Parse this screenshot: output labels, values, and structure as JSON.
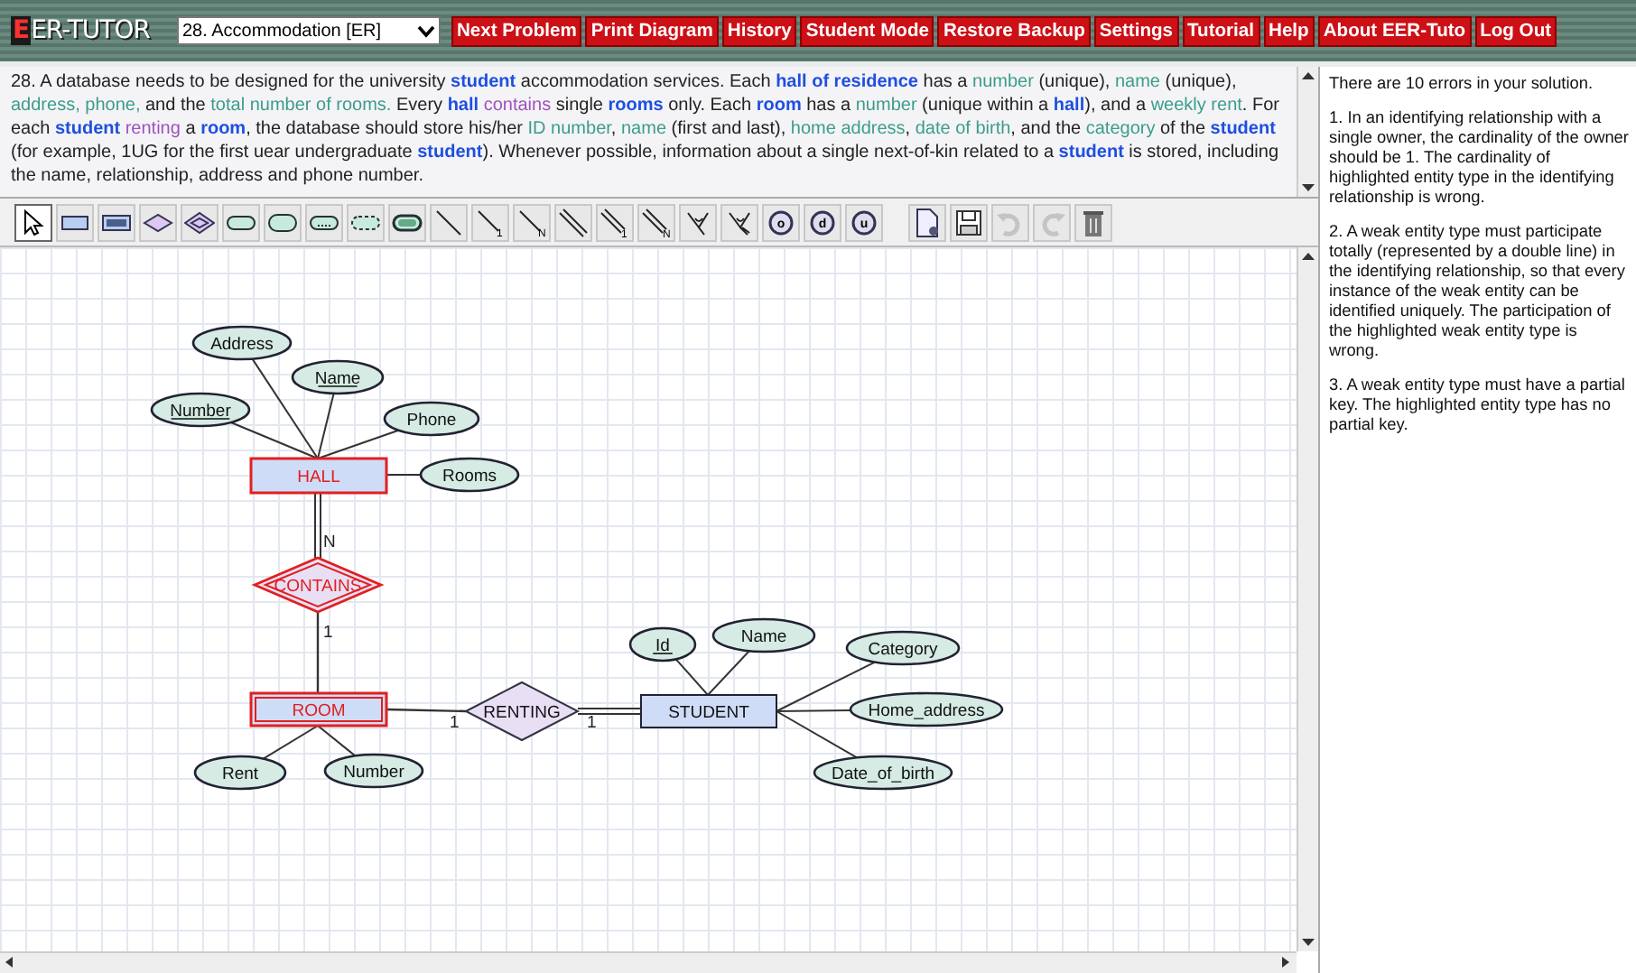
{
  "top_bar": {
    "logo": {
      "first_letter": "E",
      "rest": "ER-TUTOR"
    },
    "problem_select": {
      "value": "28. Accommodation [ER]"
    },
    "menu": [
      {
        "label": "Next Problem"
      },
      {
        "label": "Print Diagram"
      },
      {
        "label": "History"
      },
      {
        "label": "Student Mode"
      },
      {
        "label": "Restore Backup"
      },
      {
        "label": "Settings"
      },
      {
        "label": "Tutorial"
      },
      {
        "label": "Help"
      },
      {
        "label": "About EER-Tuto"
      },
      {
        "label": "Log Out"
      }
    ]
  },
  "problem_text": [
    {
      "kind": "plain",
      "text": "28. A database needs to be designed for the university "
    },
    {
      "kind": "entity",
      "text": "student"
    },
    {
      "kind": "plain",
      "text": " accommodation services. Each "
    },
    {
      "kind": "entity",
      "text": "hall of residence"
    },
    {
      "kind": "plain",
      "text": " has a "
    },
    {
      "kind": "attribute",
      "text": "number"
    },
    {
      "kind": "plain",
      "text": " (unique), "
    },
    {
      "kind": "attribute",
      "text": "name"
    },
    {
      "kind": "plain",
      "text": " (unique), "
    },
    {
      "kind": "attribute",
      "text": "address, phone,"
    },
    {
      "kind": "plain",
      "text": " and the "
    },
    {
      "kind": "attribute",
      "text": "total number of rooms."
    },
    {
      "kind": "plain",
      "text": " Every "
    },
    {
      "kind": "entity",
      "text": "hall"
    },
    {
      "kind": "relationship",
      "text": " contains"
    },
    {
      "kind": "plain",
      "text": " single "
    },
    {
      "kind": "entity",
      "text": "rooms"
    },
    {
      "kind": "plain",
      "text": " only. Each "
    },
    {
      "kind": "entity",
      "text": "room"
    },
    {
      "kind": "plain",
      "text": " has a "
    },
    {
      "kind": "attribute",
      "text": "number"
    },
    {
      "kind": "plain",
      "text": " (unique within a "
    },
    {
      "kind": "entity",
      "text": "hall"
    },
    {
      "kind": "plain",
      "text": "), and a "
    },
    {
      "kind": "attribute",
      "text": "weekly rent"
    },
    {
      "kind": "plain",
      "text": ". For each "
    },
    {
      "kind": "entity",
      "text": "student"
    },
    {
      "kind": "relationship",
      "text": " renting"
    },
    {
      "kind": "plain",
      "text": " a "
    },
    {
      "kind": "entity",
      "text": "room"
    },
    {
      "kind": "plain",
      "text": ", the database should store his/her "
    },
    {
      "kind": "attribute",
      "text": "ID number"
    },
    {
      "kind": "plain",
      "text": ", "
    },
    {
      "kind": "attribute",
      "text": "name"
    },
    {
      "kind": "plain",
      "text": " (first and last), "
    },
    {
      "kind": "attribute",
      "text": "home address"
    },
    {
      "kind": "plain",
      "text": ", "
    },
    {
      "kind": "attribute",
      "text": "date of birth"
    },
    {
      "kind": "plain",
      "text": ", and the  "
    },
    {
      "kind": "attribute",
      "text": "category"
    },
    {
      "kind": "plain",
      "text": " of the "
    },
    {
      "kind": "entity",
      "text": "student"
    },
    {
      "kind": "plain",
      "text": " (for example, 1UG for the first uear undergraduate "
    },
    {
      "kind": "entity",
      "text": "student"
    },
    {
      "kind": "plain",
      "text": "). Whenever possible, information about a single next-of-kin related to a "
    },
    {
      "kind": "entity",
      "text": "student"
    },
    {
      "kind": "plain",
      "text": " is stored, including the name, relationship, address and phone number."
    }
  ],
  "toolbar": [
    {
      "kind": "pointer",
      "selected": true
    },
    {
      "kind": "entity",
      "selected": false
    },
    {
      "kind": "weak-entity",
      "selected": false
    },
    {
      "kind": "relationship",
      "selected": false
    },
    {
      "kind": "identifying-relationship",
      "selected": false
    },
    {
      "kind": "attribute",
      "selected": false
    },
    {
      "kind": "key-attribute",
      "selected": false
    },
    {
      "kind": "partial-key-attribute",
      "selected": false
    },
    {
      "kind": "derived-attribute",
      "selected": false
    },
    {
      "kind": "multivalued-attribute",
      "selected": false
    },
    {
      "kind": "line",
      "selected": false
    },
    {
      "kind": "line-labelled",
      "glyph": "1",
      "selected": false
    },
    {
      "kind": "line-labelled",
      "glyph": "N",
      "selected": false
    },
    {
      "kind": "double-line",
      "selected": false
    },
    {
      "kind": "double-line-labelled",
      "glyph": "1",
      "selected": false
    },
    {
      "kind": "double-line-labelled",
      "glyph": "N",
      "selected": false
    },
    {
      "kind": "fork",
      "selected": false
    },
    {
      "kind": "double-fork",
      "selected": false
    },
    {
      "kind": "circle",
      "glyph": "o",
      "selected": false
    },
    {
      "kind": "circle",
      "glyph": "d",
      "selected": false
    },
    {
      "kind": "circle",
      "glyph": "u",
      "selected": false
    },
    {
      "kind": "new-document",
      "selected": false
    },
    {
      "kind": "save",
      "selected": false
    },
    {
      "kind": "undo",
      "disabled": true,
      "selected": false
    },
    {
      "kind": "redo",
      "disabled": true,
      "selected": false
    },
    {
      "kind": "trash",
      "selected": false
    }
  ],
  "diagram": {
    "entities": [
      {
        "name": "HALL",
        "weak": false,
        "error": true,
        "attributes": [
          {
            "name": "Address",
            "key": false
          },
          {
            "name": "Name",
            "key": true
          },
          {
            "name": "Number",
            "key": true
          },
          {
            "name": "Phone",
            "key": false
          },
          {
            "name": "Rooms",
            "key": false
          }
        ]
      },
      {
        "name": "ROOM",
        "weak": true,
        "error": true,
        "attributes": [
          {
            "name": "Rent",
            "key": false
          },
          {
            "name": "Number",
            "key": false
          }
        ]
      },
      {
        "name": "STUDENT",
        "weak": false,
        "error": false,
        "attributes": [
          {
            "name": "Id",
            "key": true
          },
          {
            "name": "Name",
            "key": false
          },
          {
            "name": "Category",
            "key": false
          },
          {
            "name": "Home_address",
            "key": false
          },
          {
            "name": "Date_of_birth",
            "key": false
          }
        ]
      }
    ],
    "relationships": [
      {
        "name": "CONTAINS",
        "identifying": true,
        "error": true,
        "sides": [
          {
            "cardinality": "N",
            "total": true
          },
          {
            "cardinality": "1",
            "total": false
          }
        ]
      },
      {
        "name": "RENTING",
        "identifying": false,
        "error": false,
        "sides": [
          {
            "cardinality": "1",
            "total": false
          },
          {
            "cardinality": "1",
            "total": true
          }
        ]
      }
    ]
  },
  "feedback": [
    {
      "text": "There are 10 errors in your solution."
    },
    {
      "text": "1. In an identifying relationship with a single owner, the cardinality of the owner should be 1. The cardinality of highlighted entity type in the identifying relationship is wrong."
    },
    {
      "text": "2. A weak entity type must participate totally (represented by a double line) in the identifying relationship, so that every instance of the weak entity can be identified uniquely. The participation of the highlighted weak entity type is wrong."
    },
    {
      "text": "3. A weak entity type must have a partial key. The highlighted entity type has no partial key."
    }
  ]
}
